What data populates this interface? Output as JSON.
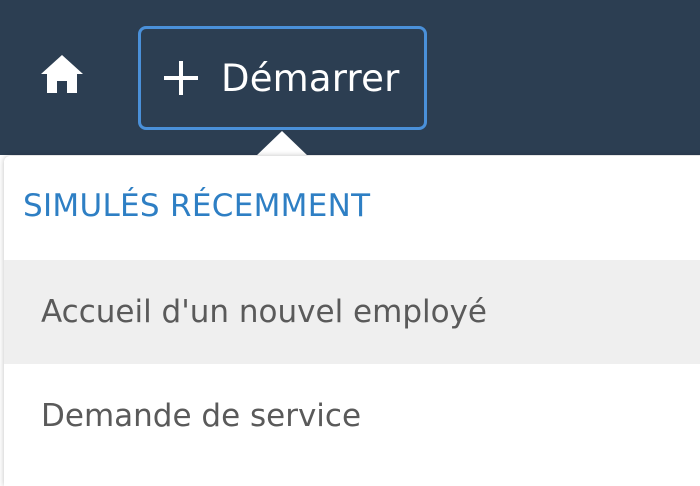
{
  "header": {
    "home_icon": "home-icon",
    "start_button": {
      "icon": "plus-icon",
      "label": "Démarrer"
    }
  },
  "dropdown": {
    "section_title": "SIMULÉS RÉCEMMENT",
    "items": [
      {
        "label": "Accueil d'un nouvel employé",
        "highlighted": true
      },
      {
        "label": "Demande de service",
        "highlighted": false
      }
    ]
  },
  "colors": {
    "topbar_bg": "#2c3e52",
    "accent_border": "#4a90d9",
    "section_title": "#2e7fc4",
    "item_text": "#5a5a5a",
    "item_hover_bg": "#efefef"
  }
}
